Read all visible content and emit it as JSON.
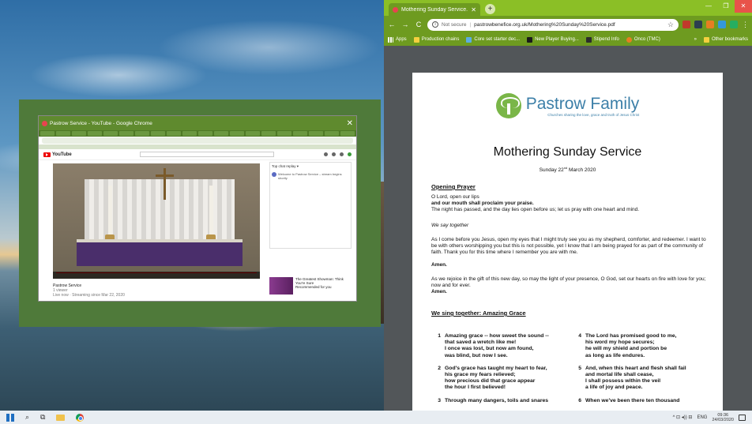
{
  "youtube_window": {
    "title": "Pastrow Service - YouTube - Google Chrome",
    "close_glyph": "✕",
    "logo_text": "YouTube",
    "video_title": "Pastrow Service",
    "video_subtitle": "1 viewer",
    "video_info": "Live now · Streaming since Mar 22, 2020",
    "chat_title": "Top chat replay ▾",
    "chat_line": "Welcome to Pastrow Service – stream begins shortly",
    "rec_title": "The Greatest Showman: Think You're Sure",
    "rec_meta": "Recommended for you"
  },
  "chrome": {
    "tab_title": "Mothering Sunday Service.pdf",
    "tab_close": "✕",
    "new_tab": "+",
    "window_controls": [
      "—",
      "❐",
      "✕"
    ],
    "nav": {
      "back": "←",
      "forward": "→",
      "reload": "C"
    },
    "not_secure": "Not secure",
    "url_separator": "|",
    "url": "pastrowbenefice.org.uk/Mothering%20Sunday%20Service.pdf",
    "star": "☆",
    "menu": "⋮",
    "bookmarks": [
      {
        "label": "Apps",
        "icon": "apps-grid-icon"
      },
      {
        "label": "Production chains",
        "icon": "bookmark-icon"
      },
      {
        "label": "Core set starter dec...",
        "icon": "bookmark-icon"
      },
      {
        "label": "New Player Buying...",
        "icon": "bookmark-icon"
      },
      {
        "label": "Stipend Info",
        "icon": "bookmark-icon"
      },
      {
        "label": "Onco (TMC)",
        "icon": "bookmark-icon"
      }
    ],
    "bookmarks_more": "»",
    "other_bookmarks": "Other bookmarks"
  },
  "pdf": {
    "brand": "Pastrow Family",
    "tagline": "Churches sharing the love, grace and truth of Jesus Christ",
    "title": "Mothering Sunday Service",
    "date_prefix": "Sunday 22",
    "date_sup": "nd",
    "date_suffix": " March 2020",
    "opening_prayer_heading": "Opening Prayer",
    "line1": "O Lord, open our lips",
    "line2": "and our mouth shall proclaim your praise.",
    "line3": "The night has passed, and the day lies open before us; let us pray with one heart and mind.",
    "we_say": "We say together",
    "para1": "As I come before you Jesus, open my eyes that I might truly see you as my shepherd, comforter, and redeemer.  I want to be with others worshipping you but this is not possible, yet I know that I am being prayed for as part of the community of faith.  Thank you for this time where I remember you are with me.",
    "amen1": "Amen.",
    "para2": "As we rejoice in the gift of this new day, so may the light of your presence, O God, set our hearts on fire with love for you; now and for ever.",
    "amen2": "Amen.",
    "sing_heading": "We sing together:  Amazing Grace",
    "hymn_left": [
      {
        "n": "1",
        "lines": "Amazing grace -- how sweet the sound --\nthat saved a wretch like me!\nI once was lost, but now am found,\nwas blind, but now I see."
      },
      {
        "n": "2",
        "lines": "God's grace has taught my heart to fear,\nhis grace my fears relieved;\nhow precious did that grace appear\nthe hour I first believed!"
      },
      {
        "n": "3",
        "lines": "Through many dangers, toils and snares"
      }
    ],
    "hymn_right": [
      {
        "n": "4",
        "lines": "The Lord has promised good to me,\nhis word my hope secures;\nhe will my shield and portion be\nas long as life endures."
      },
      {
        "n": "5",
        "lines": "And, when this heart and flesh shall fail\nand mortal life shall cease,\nI shall possess within the veil\na life of joy and peace."
      },
      {
        "n": "6",
        "lines": "When we've been there ten thousand"
      }
    ]
  },
  "taskbar": {
    "search_glyph": "⌕",
    "taskview_glyph": "⧉",
    "tray_text": "^ ⊡ ◂)) ⊟",
    "language": "ENG",
    "time": "09:36",
    "date": "24/03/2020"
  }
}
